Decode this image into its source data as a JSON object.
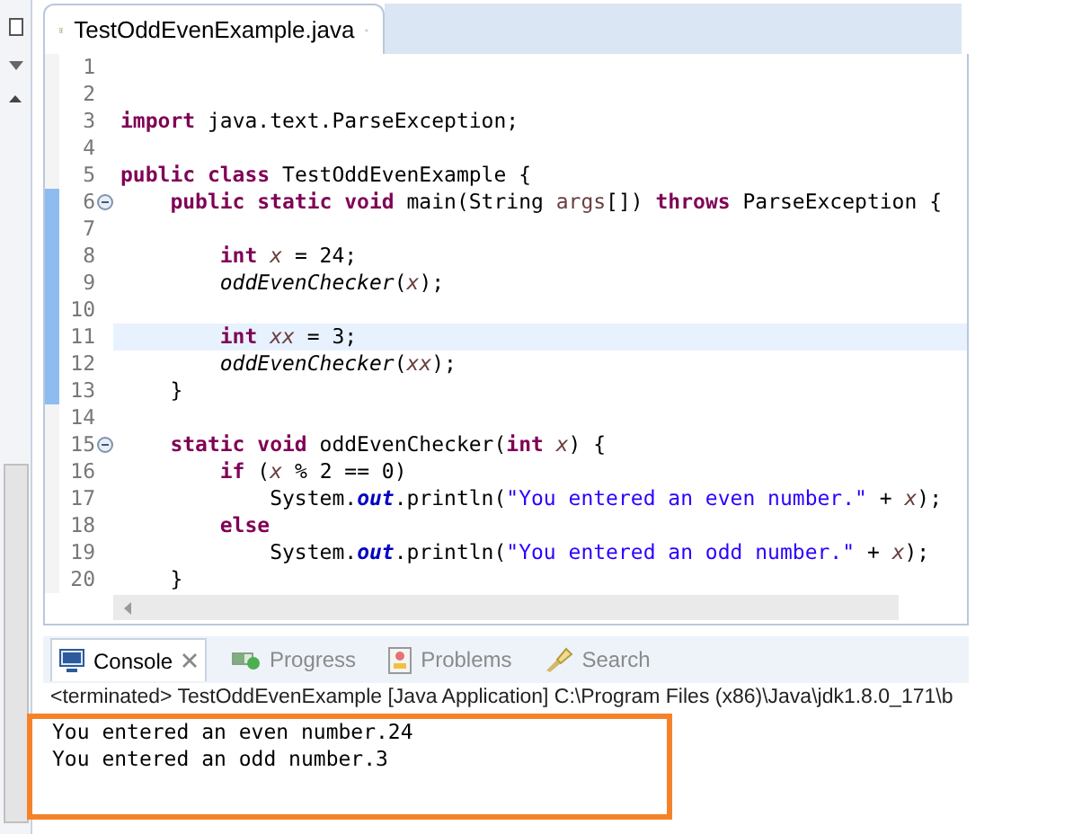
{
  "editor_tab": {
    "title": "TestOddEvenExample.java",
    "selected": true
  },
  "code_lines": [
    {
      "number": "1",
      "highlighted": false,
      "changed": false,
      "fold_marker": false
    },
    {
      "number": "2",
      "highlighted": false,
      "changed": false,
      "fold_marker": false
    },
    {
      "number": "3",
      "highlighted": false,
      "changed": false,
      "fold_marker": false,
      "tokens": [
        {
          "kind": "keyword",
          "text": "import"
        },
        {
          "kind": "plain",
          "text": " java.text.ParseException;"
        }
      ]
    },
    {
      "number": "4",
      "highlighted": false,
      "changed": false,
      "fold_marker": false
    },
    {
      "number": "5",
      "highlighted": false,
      "changed": false,
      "fold_marker": false,
      "tokens": [
        {
          "kind": "keyword",
          "text": "public class"
        },
        {
          "kind": "plain",
          "text": " TestOddEvenExample {"
        }
      ]
    },
    {
      "number": "6",
      "highlighted": false,
      "changed": true,
      "fold_marker": true,
      "tokens": [
        {
          "kind": "keyword",
          "text": "    public static void"
        },
        {
          "kind": "plain",
          "text": " main(String "
        },
        {
          "kind": "param",
          "text": "args"
        },
        {
          "kind": "plain",
          "text": "[]) "
        },
        {
          "kind": "keyword",
          "text": "throws"
        },
        {
          "kind": "plain",
          "text": " ParseException {"
        }
      ]
    },
    {
      "number": "7",
      "highlighted": false,
      "changed": true,
      "fold_marker": false
    },
    {
      "number": "8",
      "highlighted": false,
      "changed": true,
      "fold_marker": false,
      "tokens": [
        {
          "kind": "keyword",
          "text": "        int "
        },
        {
          "kind": "variable",
          "text": "x"
        },
        {
          "kind": "plain",
          "text": " = 24;"
        }
      ]
    },
    {
      "number": "9",
      "highlighted": false,
      "changed": true,
      "fold_marker": false,
      "tokens": [
        {
          "kind": "call",
          "text": "        oddEvenChecker"
        },
        {
          "kind": "plain",
          "text": "("
        },
        {
          "kind": "variable",
          "text": "x"
        },
        {
          "kind": "plain",
          "text": ");"
        }
      ]
    },
    {
      "number": "10",
      "highlighted": false,
      "changed": true,
      "fold_marker": false
    },
    {
      "number": "11",
      "highlighted": true,
      "changed": true,
      "fold_marker": false,
      "tokens": [
        {
          "kind": "keyword",
          "text": "        int "
        },
        {
          "kind": "variable",
          "text": "xx"
        },
        {
          "kind": "plain",
          "text": " = 3;"
        }
      ]
    },
    {
      "number": "12",
      "highlighted": false,
      "changed": true,
      "fold_marker": false,
      "tokens": [
        {
          "kind": "call",
          "text": "        oddEvenChecker"
        },
        {
          "kind": "plain",
          "text": "("
        },
        {
          "kind": "variable",
          "text": "xx"
        },
        {
          "kind": "plain",
          "text": ");"
        }
      ]
    },
    {
      "number": "13",
      "highlighted": false,
      "changed": true,
      "fold_marker": false,
      "tokens": [
        {
          "kind": "plain",
          "text": "    }"
        }
      ]
    },
    {
      "number": "14",
      "highlighted": false,
      "changed": false,
      "fold_marker": false
    },
    {
      "number": "15",
      "highlighted": false,
      "changed": false,
      "fold_marker": true,
      "tokens": [
        {
          "kind": "keyword",
          "text": "    static void"
        },
        {
          "kind": "plain",
          "text": " oddEvenChecker("
        },
        {
          "kind": "keyword",
          "text": "int "
        },
        {
          "kind": "variable",
          "text": "x"
        },
        {
          "kind": "plain",
          "text": ") {"
        }
      ]
    },
    {
      "number": "16",
      "highlighted": false,
      "changed": false,
      "fold_marker": false,
      "tokens": [
        {
          "kind": "keyword",
          "text": "        if"
        },
        {
          "kind": "plain",
          "text": " ("
        },
        {
          "kind": "variable",
          "text": "x"
        },
        {
          "kind": "plain",
          "text": " % 2 == 0)"
        }
      ]
    },
    {
      "number": "17",
      "highlighted": false,
      "changed": false,
      "fold_marker": false,
      "tokens": [
        {
          "kind": "plain",
          "text": "            System."
        },
        {
          "kind": "field",
          "text": "out"
        },
        {
          "kind": "plain",
          "text": ".println("
        },
        {
          "kind": "string",
          "text": "\"You entered an even number.\""
        },
        {
          "kind": "plain",
          "text": " + "
        },
        {
          "kind": "variable",
          "text": "x"
        },
        {
          "kind": "plain",
          "text": ");"
        }
      ]
    },
    {
      "number": "18",
      "highlighted": false,
      "changed": false,
      "fold_marker": false,
      "tokens": [
        {
          "kind": "keyword",
          "text": "        else"
        }
      ]
    },
    {
      "number": "19",
      "highlighted": false,
      "changed": false,
      "fold_marker": false,
      "tokens": [
        {
          "kind": "plain",
          "text": "            System."
        },
        {
          "kind": "field",
          "text": "out"
        },
        {
          "kind": "plain",
          "text": ".println("
        },
        {
          "kind": "string",
          "text": "\"You entered an odd number.\""
        },
        {
          "kind": "plain",
          "text": " + "
        },
        {
          "kind": "variable",
          "text": "x"
        },
        {
          "kind": "plain",
          "text": ");"
        }
      ]
    },
    {
      "number": "20",
      "highlighted": false,
      "changed": false,
      "fold_marker": false,
      "tokens": [
        {
          "kind": "plain",
          "text": "    }"
        }
      ]
    }
  ],
  "console": {
    "tabs": [
      {
        "label": "Console",
        "selected": true,
        "kind": "console"
      },
      {
        "label": "Progress",
        "selected": false,
        "kind": "progress"
      },
      {
        "label": "Problems",
        "selected": false,
        "kind": "problems"
      },
      {
        "label": "Search",
        "selected": false,
        "kind": "search"
      }
    ],
    "status_line": "<terminated> TestOddEvenExample [Java Application] C:\\Program Files (x86)\\Java\\jdk1.8.0_171\\b",
    "output": [
      "You entered an even number.24",
      "You entered an odd number.3"
    ]
  }
}
